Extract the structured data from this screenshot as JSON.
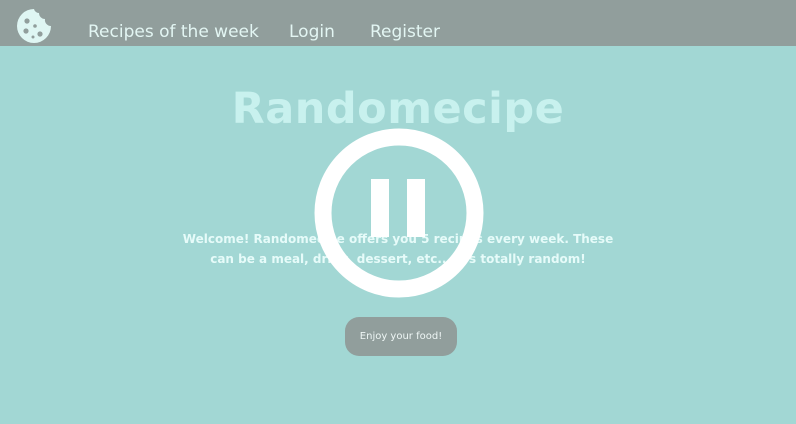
{
  "header": {
    "logo_icon": "cookie-icon",
    "nav": [
      {
        "label": "Recipes of the week"
      },
      {
        "label": "Login"
      },
      {
        "label": "Register"
      }
    ]
  },
  "hero": {
    "title": "Randomecipe",
    "welcome": "Welcome! Randomecipe offers you 5 recipes every week. These can be a meal, drink, dessert, etc... It's totally random!",
    "button_label": "Enjoy your food!"
  },
  "overlay": {
    "icon": "pause-icon"
  },
  "colors": {
    "page_bg": "#a2d7d4",
    "navbar_bg": "#919e9c",
    "title": "#c8f1ee",
    "button_bg": "#919e9c"
  }
}
